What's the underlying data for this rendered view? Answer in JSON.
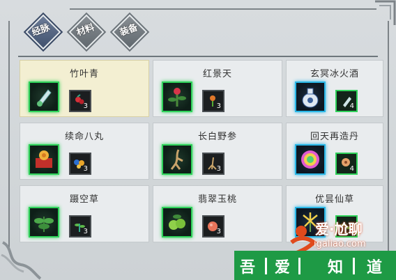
{
  "tabs": [
    {
      "label": "经脉",
      "active": true
    },
    {
      "label": "材料",
      "active": false
    },
    {
      "label": "装备",
      "active": false
    }
  ],
  "recipes": [
    {
      "name": "竹叶青",
      "rarity": "green",
      "material_count": "3",
      "selected": true
    },
    {
      "name": "红景天",
      "rarity": "green",
      "material_count": "3",
      "selected": false
    },
    {
      "name": "玄冥冰火酒",
      "rarity": "blue",
      "material_count": "4",
      "selected": false
    },
    {
      "name": "续命八丸",
      "rarity": "green",
      "material_count": "3",
      "selected": false
    },
    {
      "name": "长白野参",
      "rarity": "green",
      "material_count": "3",
      "selected": false
    },
    {
      "name": "回天再造丹",
      "rarity": "blue",
      "material_count": "4",
      "selected": false
    },
    {
      "name": "蹑空草",
      "rarity": "green",
      "material_count": "3",
      "selected": false
    },
    {
      "name": "翡翠玉桃",
      "rarity": "green",
      "material_count": "3",
      "selected": false
    },
    {
      "name": "优昙仙草",
      "rarity": "blue",
      "material_count": "4",
      "selected": false
    }
  ],
  "watermark": {
    "site_cn": "爱·尬聊",
    "site_url": "igaliao.com",
    "slogan": [
      "吾",
      "爱",
      "知",
      "道"
    ]
  },
  "colors": {
    "green_rarity": "#2fd25a",
    "blue_rarity": "#29b6e6",
    "selected_card": "#f3efd2",
    "watermark_green": "#1e9a45"
  }
}
